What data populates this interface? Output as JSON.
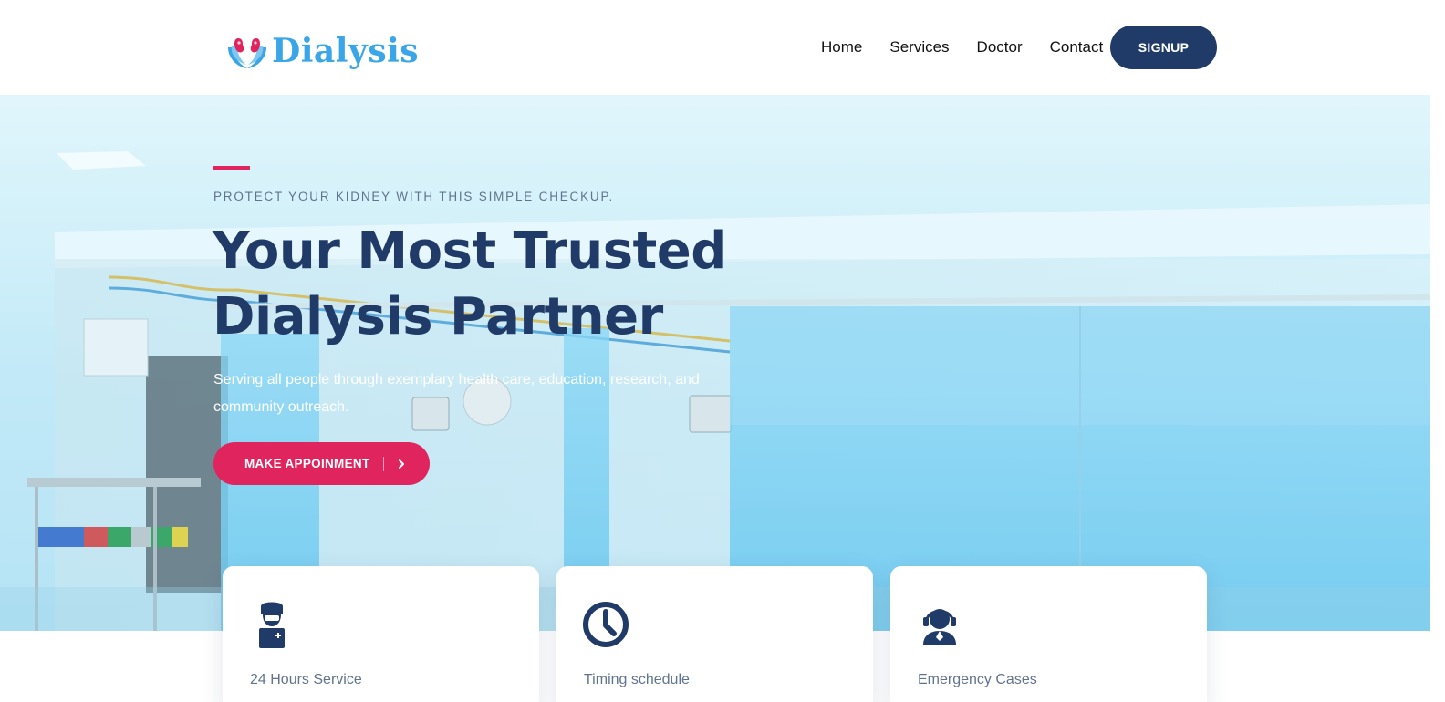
{
  "brand": {
    "name": "Dialysis",
    "logo_icon": "kidney-hands-icon",
    "colors": {
      "logo_text": "#3aa6e8",
      "kidney": "#e0245e"
    }
  },
  "nav": {
    "links": [
      "Home",
      "Services",
      "Doctor",
      "Contact"
    ],
    "signup_label": "SIGNUP"
  },
  "hero": {
    "eyebrow": "PROTECT YOUR KIDNEY WITH THIS SIMPLE CHECKUP.",
    "headline_line1": "Your Most Trusted",
    "headline_line2": "Dialysis Partner",
    "subtext": "Serving all people through exemplary health care, education, research, and community outreach.",
    "cta_label": "MAKE APPOINMENT",
    "cta_icon": "chevron-right-icon"
  },
  "cards": [
    {
      "title": "24 Hours Service",
      "icon": "doctor-icon"
    },
    {
      "title": "Timing schedule",
      "icon": "clock-icon"
    },
    {
      "title": "Emergency Cases",
      "icon": "headset-support-icon"
    }
  ],
  "colors": {
    "primary_navy": "#213b69",
    "accent_pink": "#e0245e",
    "muted_text": "#61748f",
    "nav_text": "#111111"
  }
}
